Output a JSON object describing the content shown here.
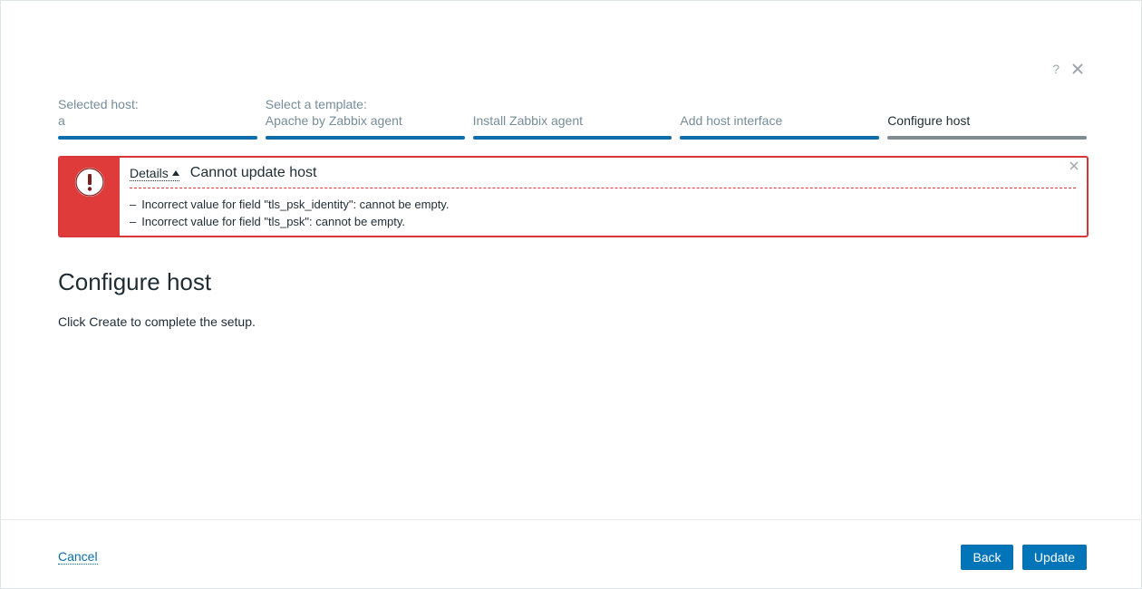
{
  "header": {
    "help_label": "?"
  },
  "steps": [
    {
      "label": "Selected host:",
      "value": "a"
    },
    {
      "label": "Select a template:",
      "value": "Apache by Zabbix agent"
    },
    {
      "label": "",
      "value": "Install Zabbix agent"
    },
    {
      "label": "",
      "value": "Add host interface"
    },
    {
      "label": "",
      "value": "Configure host",
      "current": true
    }
  ],
  "error": {
    "details_label": "Details",
    "title": "Cannot update host",
    "messages": [
      "Incorrect value for field \"tls_psk_identity\": cannot be empty.",
      "Incorrect value for field \"tls_psk\": cannot be empty."
    ],
    "dash": "–",
    "icon": "exclamation-icon",
    "color": "#e03b3b"
  },
  "main": {
    "title": "Configure host",
    "description": "Click Create to complete the setup."
  },
  "footer": {
    "cancel_label": "Cancel",
    "back_label": "Back",
    "update_label": "Update"
  },
  "colors": {
    "accent": "#0275b8",
    "error": "#d9363a",
    "step_done": "#0b6ea9",
    "step_current": "#7e8b92"
  }
}
